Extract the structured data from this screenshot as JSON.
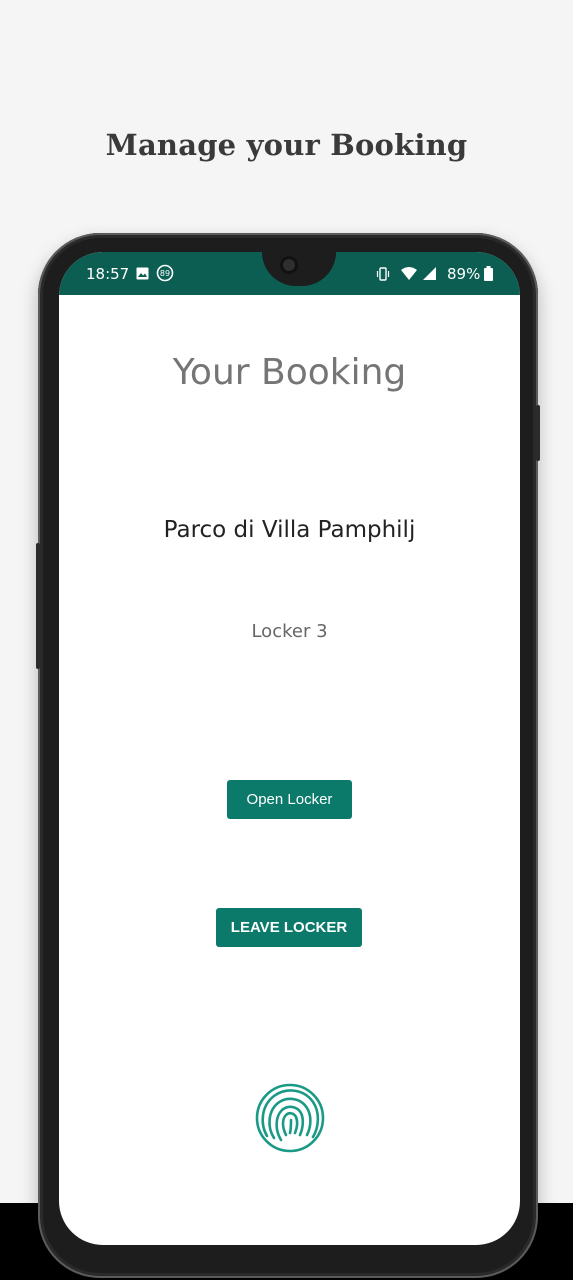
{
  "header": {
    "title": "Manage your Booking"
  },
  "status_bar": {
    "time": "18:57",
    "badge": "89",
    "battery": "89%"
  },
  "screen": {
    "title": "Your Booking",
    "location": "Parco di Villa Pamphilj",
    "locker": "Locker 3",
    "open_button": "Open Locker",
    "leave_button": "LEAVE LOCKER"
  },
  "colors": {
    "accent": "#0b7a6b",
    "status_bar": "#0b5e51",
    "fingerprint": "#1a9a86"
  },
  "icons": [
    "image-icon",
    "notification-badge-icon",
    "vibrate-icon",
    "wifi-icon",
    "signal-icon",
    "battery-icon",
    "fingerprint-icon"
  ]
}
